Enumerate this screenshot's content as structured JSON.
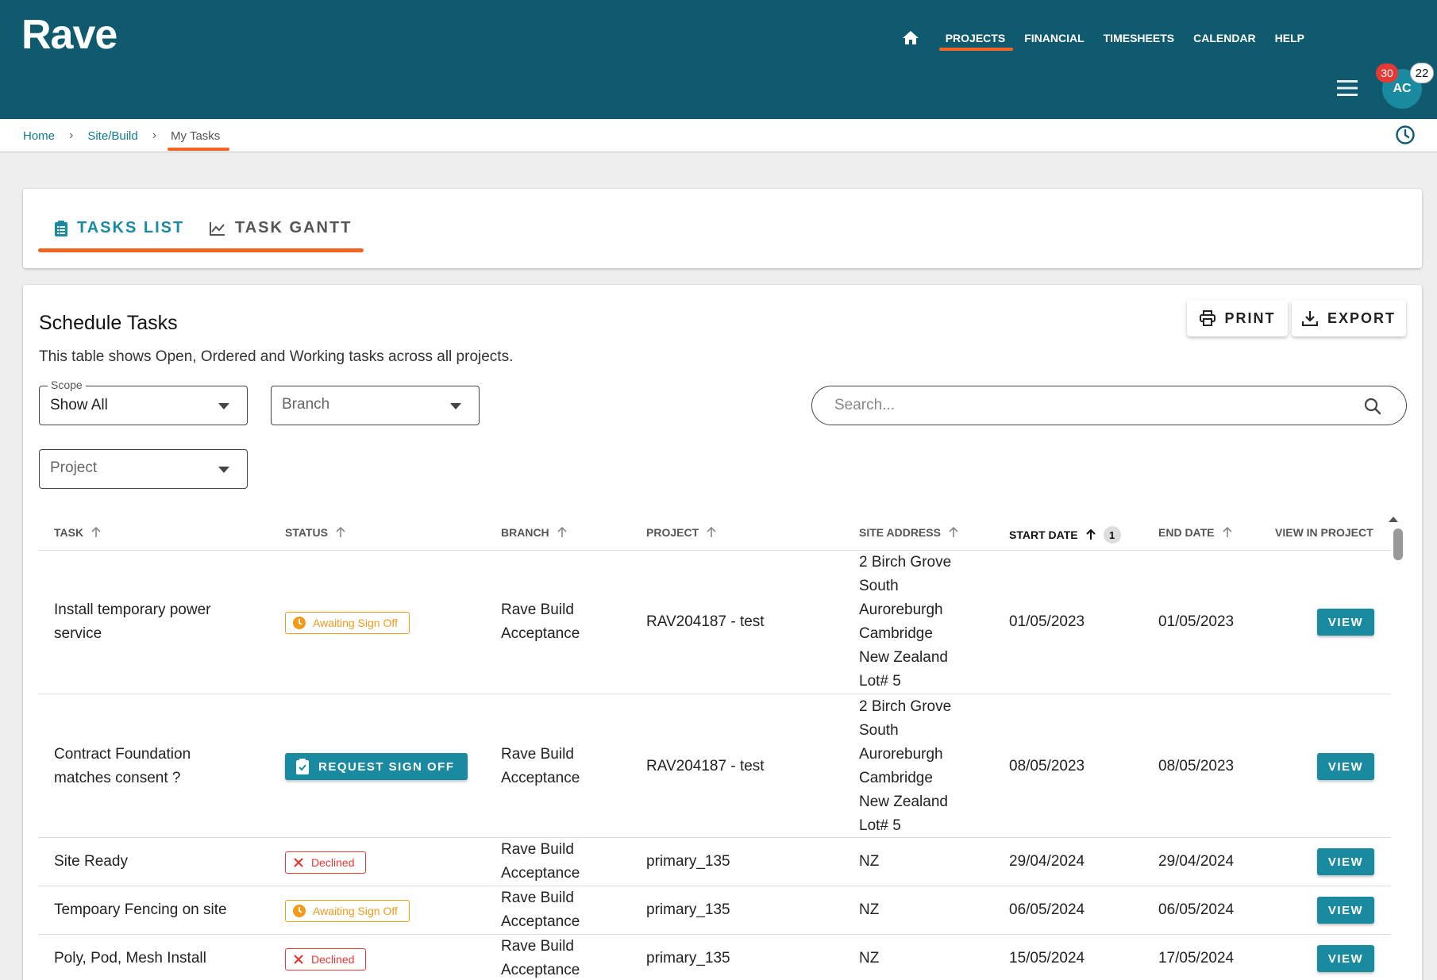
{
  "app": {
    "logo": "Rave"
  },
  "nav": {
    "items": [
      {
        "label": "PROJECTS",
        "active": true
      },
      {
        "label": "FINANCIAL",
        "active": false
      },
      {
        "label": "TIMESHEETS",
        "active": false
      },
      {
        "label": "CALENDAR",
        "active": false
      },
      {
        "label": "HELP",
        "active": false
      }
    ]
  },
  "user": {
    "initials": "AC",
    "notifications": "30",
    "messages": "22"
  },
  "breadcrumb": {
    "home": "Home",
    "site": "Site/Build",
    "current": "My Tasks",
    "separator": "›"
  },
  "tabs": {
    "list": "TASKS LIST",
    "gantt": "TASK GANTT"
  },
  "section": {
    "title": "Schedule Tasks",
    "description": "This table shows Open, Ordered and Working tasks across all projects."
  },
  "actions": {
    "print": "PRINT",
    "export": "EXPORT"
  },
  "filters": {
    "scope_label": "Scope",
    "scope_value": "Show All",
    "branch_placeholder": "Branch",
    "project_placeholder": "Project",
    "search_placeholder": "Search..."
  },
  "table": {
    "headers": {
      "task": "TASK",
      "status": "STATUS",
      "branch": "BRANCH",
      "project": "PROJECT",
      "site_address": "SITE ADDRESS",
      "start_date": "START DATE",
      "start_date_sort_order": "1",
      "end_date": "END DATE",
      "view": "VIEW IN PROJECT"
    },
    "view_label": "VIEW",
    "rows": [
      {
        "task": "Install temporary power\nservice",
        "status": "Awaiting Sign Off",
        "branch": "Rave Build\nAcceptance",
        "project": "RAV204187 - test",
        "address": "2 Birch Grove\nSouth\nAuroreburgh\nCambridge\nNew Zealand\nLot# 5",
        "start": "01/05/2023",
        "end": "01/05/2023"
      },
      {
        "task": "Contract Foundation\nmatches consent ?",
        "status": "REQUEST SIGN OFF",
        "branch": "Rave Build\nAcceptance",
        "project": "RAV204187 - test",
        "address": "2 Birch Grove\nSouth\nAuroreburgh\nCambridge\nNew Zealand\nLot# 5",
        "start": "08/05/2023",
        "end": "08/05/2023"
      },
      {
        "task": "Site Ready",
        "status": "Declined",
        "branch": "Rave Build\nAcceptance",
        "project": "primary_135",
        "address": "NZ",
        "start": "29/04/2024",
        "end": "29/04/2024"
      },
      {
        "task": "Tempoary Fencing on site",
        "status": "Awaiting Sign Off",
        "branch": "Rave Build\nAcceptance",
        "project": "primary_135",
        "address": "NZ",
        "start": "06/05/2024",
        "end": "06/05/2024"
      },
      {
        "task": "Poly, Pod, Mesh Install",
        "status": "Declined",
        "branch": "Rave Build\nAcceptance",
        "project": "primary_135",
        "address": "NZ",
        "start": "15/05/2024",
        "end": "17/05/2024"
      }
    ]
  },
  "colors": {
    "header_bg": "#0f5a6e",
    "accent": "#1a8aa0",
    "highlight": "#f26522",
    "awaiting": "#f29a1b",
    "declined": "#e53935"
  }
}
